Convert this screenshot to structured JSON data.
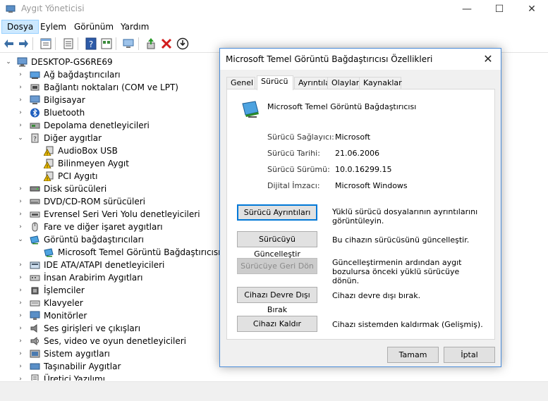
{
  "window": {
    "title": "Aygıt Yöneticisi",
    "minimize": "—",
    "maximize": "☐",
    "close": "✕"
  },
  "menu": [
    "Dosya",
    "Eylem",
    "Görünüm",
    "Yardım"
  ],
  "tree": {
    "root": "DESKTOP-GS6RE69",
    "items": [
      {
        "label": "Ağ bağdaştırıcıları",
        "icon": "network-adapter-icon",
        "expander": "›"
      },
      {
        "label": "Bağlantı noktaları (COM ve LPT)",
        "icon": "port-icon",
        "expander": "›"
      },
      {
        "label": "Bilgisayar",
        "icon": "computer-icon",
        "expander": "›"
      },
      {
        "label": "Bluetooth",
        "icon": "bluetooth-icon",
        "expander": "›"
      },
      {
        "label": "Depolama denetleyicileri",
        "icon": "storage-controller-icon",
        "expander": "›"
      },
      {
        "label": "Diğer aygıtlar",
        "icon": "other-devices-icon",
        "expander": "⌄"
      },
      {
        "label": "AudioBox USB",
        "icon": "warning-device-icon",
        "child": true
      },
      {
        "label": "Bilinmeyen Aygıt",
        "icon": "warning-device-icon",
        "child": true
      },
      {
        "label": "PCI Aygıtı",
        "icon": "warning-device-icon",
        "child": true
      },
      {
        "label": "Disk sürücüleri",
        "icon": "disk-drive-icon",
        "expander": "›"
      },
      {
        "label": "DVD/CD-ROM sürücüleri",
        "icon": "dvd-icon",
        "expander": "›"
      },
      {
        "label": "Evrensel Seri Veri Yolu denetleyicileri",
        "icon": "usb-icon",
        "expander": "›"
      },
      {
        "label": "Fare ve diğer işaret aygıtları",
        "icon": "mouse-icon",
        "expander": "›"
      },
      {
        "label": "Görüntü bağdaştırıcıları",
        "icon": "display-adapter-icon",
        "expander": "⌄"
      },
      {
        "label": "Microsoft Temel Görüntü Bağdaştırıcısı",
        "icon": "display-adapter-icon",
        "child": true
      },
      {
        "label": "IDE ATA/ATAPI denetleyicileri",
        "icon": "ide-icon",
        "expander": "›"
      },
      {
        "label": "İnsan Arabirim Aygıtları",
        "icon": "hid-icon",
        "expander": "›"
      },
      {
        "label": "İşlemciler",
        "icon": "processor-icon",
        "expander": "›"
      },
      {
        "label": "Klavyeler",
        "icon": "keyboard-icon",
        "expander": "›"
      },
      {
        "label": "Monitörler",
        "icon": "monitor-icon",
        "expander": "›"
      },
      {
        "label": "Ses girişleri ve çıkışları",
        "icon": "speaker-icon",
        "expander": "›"
      },
      {
        "label": "Ses, video ve oyun denetleyicileri",
        "icon": "sound-icon",
        "expander": "›"
      },
      {
        "label": "Sistem aygıtları",
        "icon": "system-device-icon",
        "expander": "›"
      },
      {
        "label": "Taşınabilir Aygıtlar",
        "icon": "portable-device-icon",
        "expander": "›"
      },
      {
        "label": "Üretici Yazılımı",
        "icon": "firmware-icon",
        "expander": "›"
      }
    ]
  },
  "dialog": {
    "title": "Microsoft Temel Görüntü Bağdaştırıcısı Özellikleri",
    "close": "✕",
    "tabs": [
      "Genel",
      "Sürücü",
      "Ayrıntılar",
      "Olaylar",
      "Kaynaklar"
    ],
    "active_tab": "Sürücü",
    "device_name": "Microsoft Temel Görüntü Bağdaştırıcısı",
    "properties": [
      {
        "label": "Sürücü Sağlayıcı:",
        "value": "Microsoft"
      },
      {
        "label": "Sürücü Tarihi:",
        "value": "21.06.2006"
      },
      {
        "label": "Sürücü Sürümü:",
        "value": "10.0.16299.15"
      },
      {
        "label": "Dijital İmzacı:",
        "value": "Microsoft Windows"
      }
    ],
    "actions": [
      {
        "label": "Sürücü Ayrıntıları",
        "desc": "Yüklü sürücü dosyalarının ayrıntılarını görüntüleyin."
      },
      {
        "label": "Sürücüyü Güncelleştir",
        "desc": "Bu cihazın sürücüsünü güncelleştir."
      },
      {
        "label": "Sürücüye Geri Dön",
        "desc": "Güncelleştirmenin ardından aygıt bozulursa önceki yüklü sürücüye dönün.",
        "disabled": true
      },
      {
        "label": "Cihazı Devre Dışı Bırak",
        "desc": "Cihazı devre dışı bırak."
      },
      {
        "label": "Cihazı Kaldır",
        "desc": "Cihazı sistemden kaldırmak (Gelişmiş)."
      }
    ],
    "ok": "Tamam",
    "cancel": "İptal"
  },
  "colors": {
    "accent": "#0078d7",
    "dialog_border": "#4a8cd9",
    "warning": "#f0c000",
    "menu_active": "#cce8ff"
  }
}
